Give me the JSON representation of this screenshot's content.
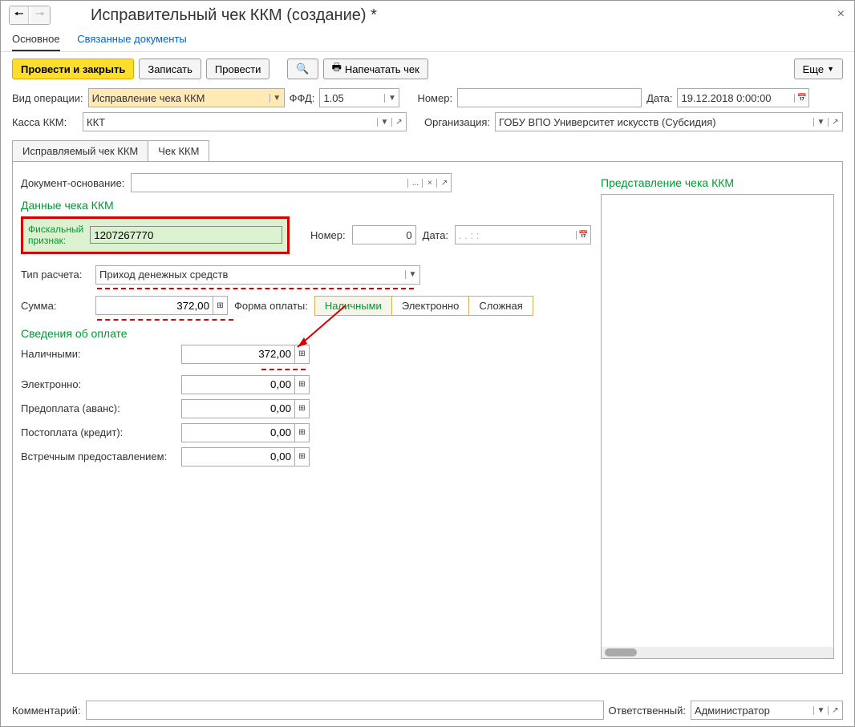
{
  "window_title": "Исправительный чек ККМ (создание) *",
  "subnav": {
    "main": "Основное",
    "related": "Связанные документы"
  },
  "toolbar": {
    "post_close": "Провести и закрыть",
    "save": "Записать",
    "post": "Провести",
    "print": "Напечатать чек",
    "more": "Еще"
  },
  "row1": {
    "op_label": "Вид операции:",
    "op_value": "Исправление чека ККМ",
    "ffd_label": "ФФД:",
    "ffd_value": "1.05",
    "num_label": "Номер:",
    "num_value": "",
    "date_label": "Дата:",
    "date_value": "19.12.2018  0:00:00"
  },
  "row2": {
    "kassa_label": "Касса ККМ:",
    "kassa_value": "ККТ",
    "org_label": "Организация:",
    "org_value": "ГОБУ ВПО Университет искусств (Субсидия)"
  },
  "tabs": {
    "t1": "Исправляемый чек ККМ",
    "t2": "Чек ККМ"
  },
  "doc_base_label": "Документ-основание:",
  "section_data": "Данные чека ККМ",
  "section_preview": "Представление чека ККМ",
  "fiscal": {
    "label1": "Фискальный",
    "label2": "признак:",
    "value": "1207267770"
  },
  "numero": {
    "label": "Номер:",
    "value": "0"
  },
  "date2": {
    "label": "Дата:",
    "value": ".  .      :  :"
  },
  "calc_type": {
    "label": "Тип расчета:",
    "value": "Приход денежных средств"
  },
  "sum": {
    "label": "Сумма:",
    "value": "372,00"
  },
  "payform": {
    "label": "Форма оплаты:",
    "opt1": "Наличными",
    "opt2": "Электронно",
    "opt3": "Сложная"
  },
  "section_pay": "Сведения об оплате",
  "pay_rows": {
    "cash": {
      "label": "Наличными:",
      "value": "372,00"
    },
    "electronic": {
      "label": "Электронно:",
      "value": "0,00"
    },
    "prepay": {
      "label": "Предоплата (аванс):",
      "value": "0,00"
    },
    "postpay": {
      "label": "Постоплата (кредит):",
      "value": "0,00"
    },
    "counter": {
      "label": "Встречным предоставлением:",
      "value": "0,00"
    }
  },
  "footer": {
    "comment_label": "Комментарий:",
    "comment_value": "",
    "resp_label": "Ответственный:",
    "resp_value": "Администратор"
  }
}
